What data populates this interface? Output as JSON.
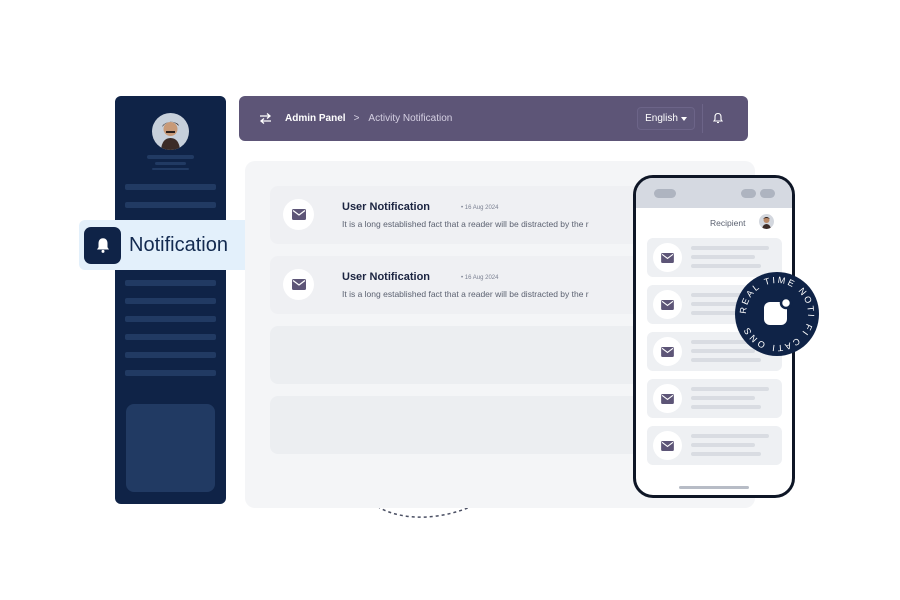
{
  "sidebar": {
    "avatar": "avatar-image"
  },
  "badge": {
    "label": "Notification",
    "icon": "bell-icon"
  },
  "header": {
    "breadcrumb_root": "Admin Panel",
    "breadcrumb_separator": ">",
    "breadcrumb_current": "Activity Notification",
    "language": "English",
    "icons": [
      "swap-icon",
      "caret-down-icon",
      "bell-icon"
    ]
  },
  "notifications": [
    {
      "title": "User Notification",
      "date": "• 16 Aug 2024",
      "body": "It is a long established fact that a reader will be distracted by the r",
      "icon": "mail-icon"
    },
    {
      "title": "User Notification",
      "date": "• 16 Aug 2024",
      "body": "It is a long established fact that a reader will be distracted by the r",
      "icon": "mail-icon"
    }
  ],
  "phone": {
    "recipient_label": "Recipient",
    "item_count": 5
  },
  "seal": {
    "text": "REAL TIME NOTI FI CATI ONS"
  },
  "colors": {
    "sidebar": "#0f2347",
    "header": "#5d5577",
    "badge_bg": "#e3f0fb",
    "mail_icon": "#5d5577"
  }
}
